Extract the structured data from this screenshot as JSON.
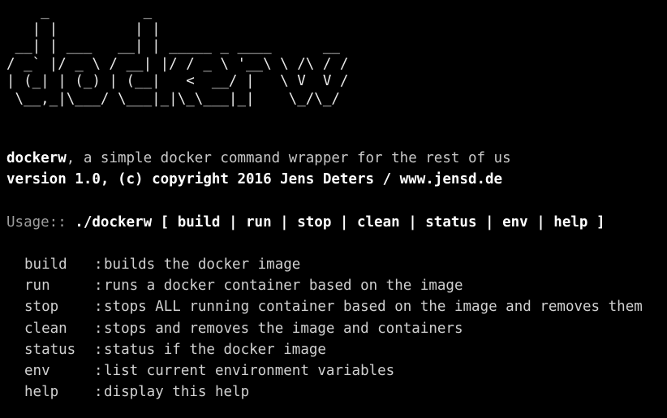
{
  "banner": {
    "ascii_logo": "    _           _\n   | |         | |\n __| | ___   __| | _____ _ ____      __\n/ _` |/ _ \\ / __| |/ / _ \\ '__\\ \\ /\\ / /\n| (_| | (_) | (__|   <  __/ |   \\ V  V /\n \\__,_|\\___/ \\___|_|\\_\\___|_|    \\_/\\_/"
  },
  "intro": {
    "name": "dockerw",
    "tagline": ", a simple docker command wrapper for the rest of us",
    "version_line": "version 1.0, (c) copyright 2016 Jens Deters / www.jensd.de"
  },
  "usage": {
    "prefix": "Usage:: ",
    "command": "./dockerw [ build | run | stop | clean | status | env | help ]"
  },
  "help_separator": ":",
  "commands": [
    {
      "name": "build",
      "description": "builds the docker image"
    },
    {
      "name": "run",
      "description": "runs a docker container based on the image"
    },
    {
      "name": "stop",
      "description": "stops ALL running container based on the image and removes them"
    },
    {
      "name": "clean",
      "description": "stops and removes the image and containers"
    },
    {
      "name": "status",
      "description": "status if the docker image"
    },
    {
      "name": "env",
      "description": "list current environment variables"
    },
    {
      "name": "help",
      "description": "display this help"
    }
  ]
}
